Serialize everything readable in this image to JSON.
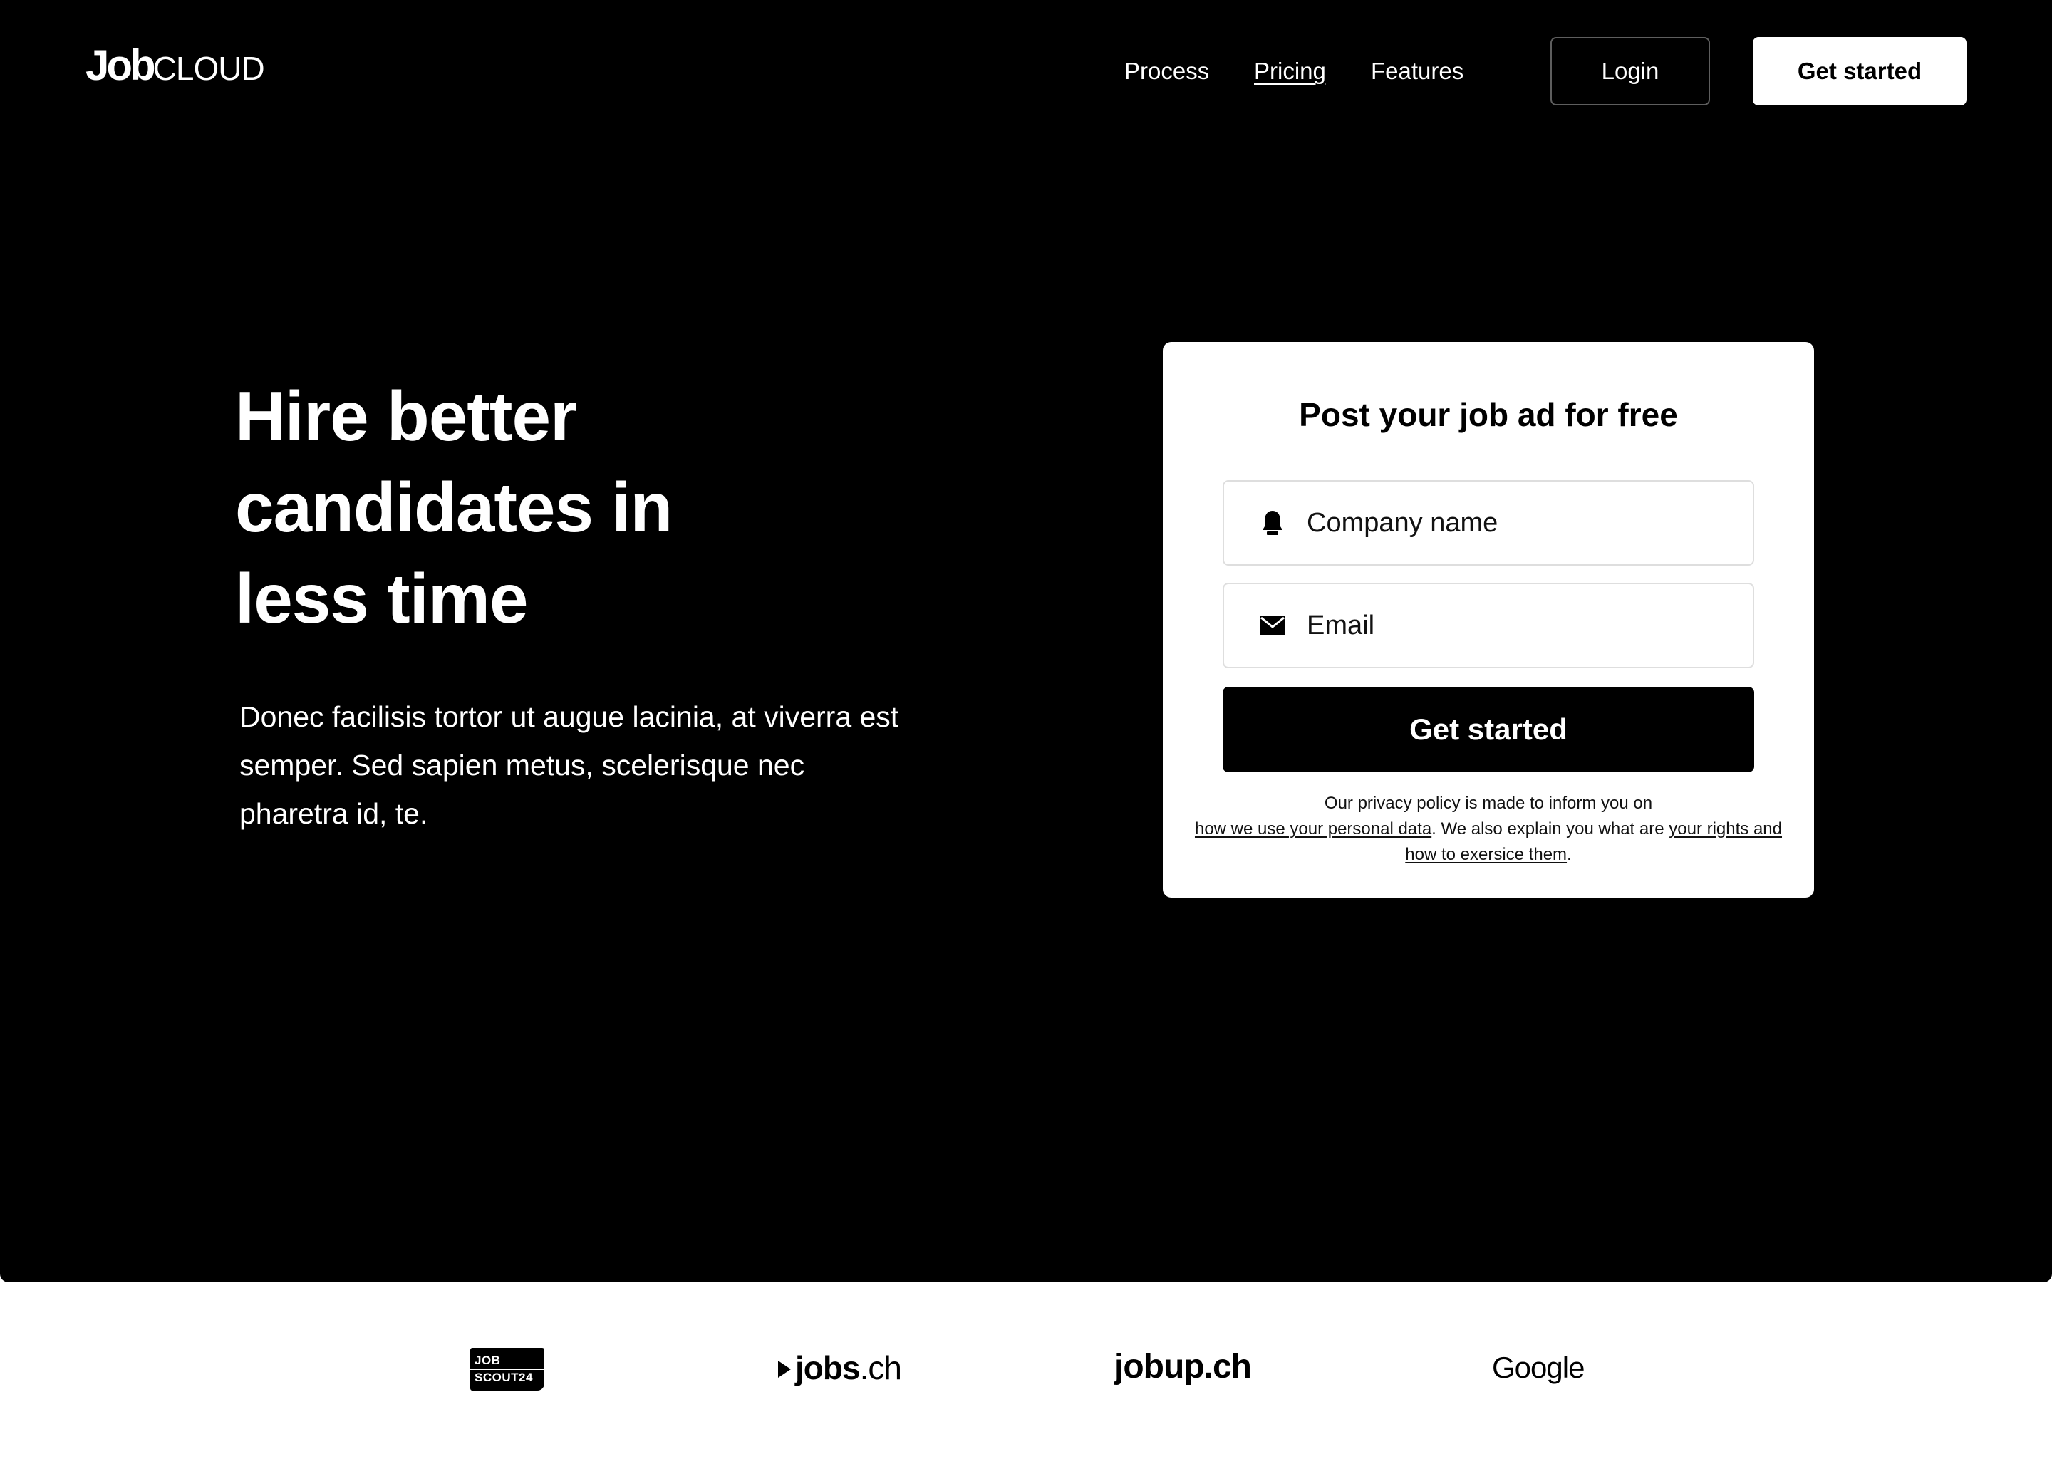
{
  "header": {
    "logo": {
      "part1": "Job",
      "part2": "CLOUD"
    },
    "nav": [
      {
        "label": "Process"
      },
      {
        "label": "Pricing"
      },
      {
        "label": "Features"
      }
    ],
    "login_label": "Login",
    "get_started_label": "Get started"
  },
  "hero": {
    "headline_lines": [
      "Hire better",
      "candidates in",
      "less time"
    ],
    "description": "Donec facilisis tortor ut augue lacinia, at viverra est semper. Sed sapien metus, scelerisque nec pharetra id, te."
  },
  "form": {
    "title": "Post your job ad for free",
    "company_placeholder": "Company name",
    "company_icon": "company-icon",
    "email_placeholder": "Email",
    "email_icon": "mail-icon",
    "submit_label": "Get started",
    "privacy": {
      "text1": "Our privacy policy is made to inform you on",
      "link1": "how we use your personal data",
      "text2": ". We also explain you what are ",
      "link2": "your rights and how to exersice them",
      "text3": "."
    }
  },
  "partners": {
    "jobscout": {
      "line1": "JOB",
      "line2": "SCOUT24"
    },
    "jobsch": {
      "bold": "jobs",
      "light": ".ch"
    },
    "jobup": "jobup.ch",
    "google": "Google"
  },
  "colors": {
    "hero_bg": "#000000",
    "page_bg": "#ffffff",
    "primary_button_bg": "#000000",
    "field_border": "#dedede"
  }
}
